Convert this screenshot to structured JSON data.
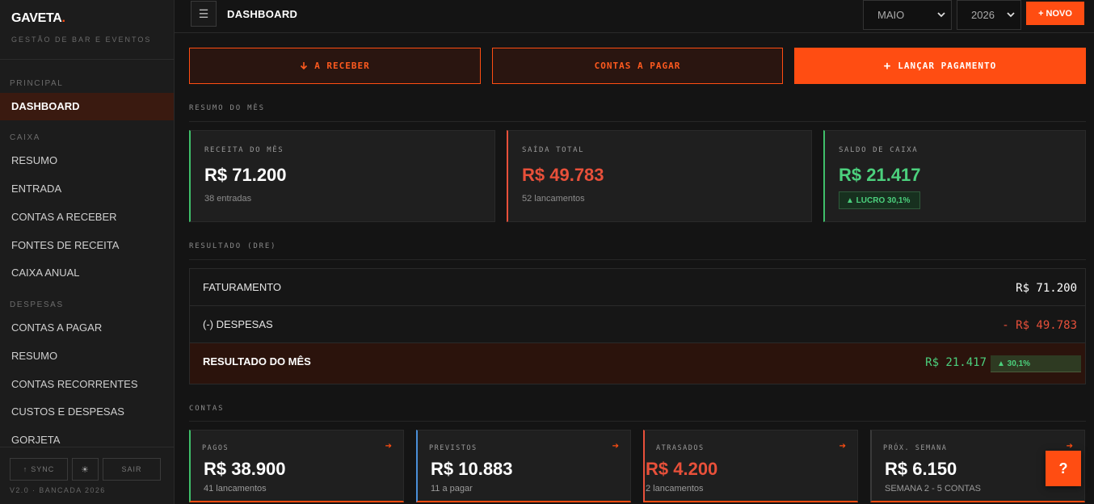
{
  "brand": {
    "name": "GAVETA",
    "dot": ".",
    "subtitle": "GESTÃO DE BAR E EVENTOS",
    "version": "V2.0 · BANCADA 2026"
  },
  "sidebar": {
    "sections": [
      {
        "label": "PRINCIPAL"
      },
      {
        "label": "CAIXA"
      },
      {
        "label": "DESPESAS"
      }
    ],
    "items": [
      {
        "label": "DASHBOARD",
        "active": true
      },
      {
        "label": "RESUMO"
      },
      {
        "label": "ENTRADA"
      },
      {
        "label": "CONTAS A RECEBER"
      },
      {
        "label": "FONTES DE RECEITA"
      },
      {
        "label": "CAIXA ANUAL"
      },
      {
        "label": "CONTAS A PAGAR"
      },
      {
        "label": "RESUMO"
      },
      {
        "label": "CONTAS RECORRENTES"
      },
      {
        "label": "CUSTOS E DESPESAS"
      },
      {
        "label": "GORJETA"
      }
    ],
    "footer": {
      "sync": "SYNC",
      "theme_icon": "sun-icon",
      "logout": "SAIR"
    }
  },
  "topbar": {
    "title": "DASHBOARD",
    "month": "MAIO",
    "year": "2026",
    "new_button": "+ NOVO"
  },
  "actions": {
    "receive": "A RECEBER",
    "pay": "CONTAS A PAGAR",
    "launch": "LANÇAR PAGAMENTO"
  },
  "summary": {
    "section_label": "RESUMO DO MÊS",
    "cards": [
      {
        "label": "RECEITA DO MÊS",
        "value": "R$ 71.200",
        "sub": "38 entradas",
        "color": "#ffffff",
        "accent": "#3fbf6a"
      },
      {
        "label": "SAÍDA TOTAL",
        "value": "R$ 49.783",
        "sub": "52 lancamentos",
        "color": "#e8503a",
        "accent": "#e8503a"
      },
      {
        "label": "SALDO DE CAIXA",
        "value": "R$ 21.417",
        "badge": "▲ LUCRO 30,1%",
        "color": "#4cd07d",
        "accent": "#3fbf6a"
      }
    ]
  },
  "dre": {
    "section_label": "RESULTADO (DRE)",
    "rows": [
      {
        "name": "FATURAMENTO",
        "amount": "R$ 71.200",
        "color": "#ffffff"
      },
      {
        "name": "(-) DESPESAS",
        "amount": "- R$ 49.783",
        "color": "#e8503a"
      },
      {
        "name": "RESULTADO DO MÊS",
        "amount": "R$ 21.417",
        "badge": "▲ 30,1%",
        "color": "#4cd07d"
      }
    ]
  },
  "accounts": {
    "section_label": "CONTAS",
    "cards": [
      {
        "label": "PAGOS",
        "value": "R$ 38.900",
        "sub": "41 lancamentos",
        "accent": "#3fbf6a",
        "value_color": "#ffffff"
      },
      {
        "label": "PREVISTOS",
        "value": "R$ 10.883",
        "sub": "11 a pagar",
        "accent": "#4a8fd8",
        "value_color": "#ffffff"
      },
      {
        "label": "ATRASADOS",
        "value": "R$ 4.200",
        "sub": "2 lancamentos",
        "accent": "#e8503a",
        "value_color": "#e8503a"
      },
      {
        "label": "PRÓX. SEMANA",
        "value": "R$ 6.150",
        "sub": "SEMANA 2 - 5 CONTAS",
        "accent": "#3a3a3a",
        "value_color": "#ffffff"
      }
    ],
    "arrow": "➔"
  },
  "help_button": "?"
}
